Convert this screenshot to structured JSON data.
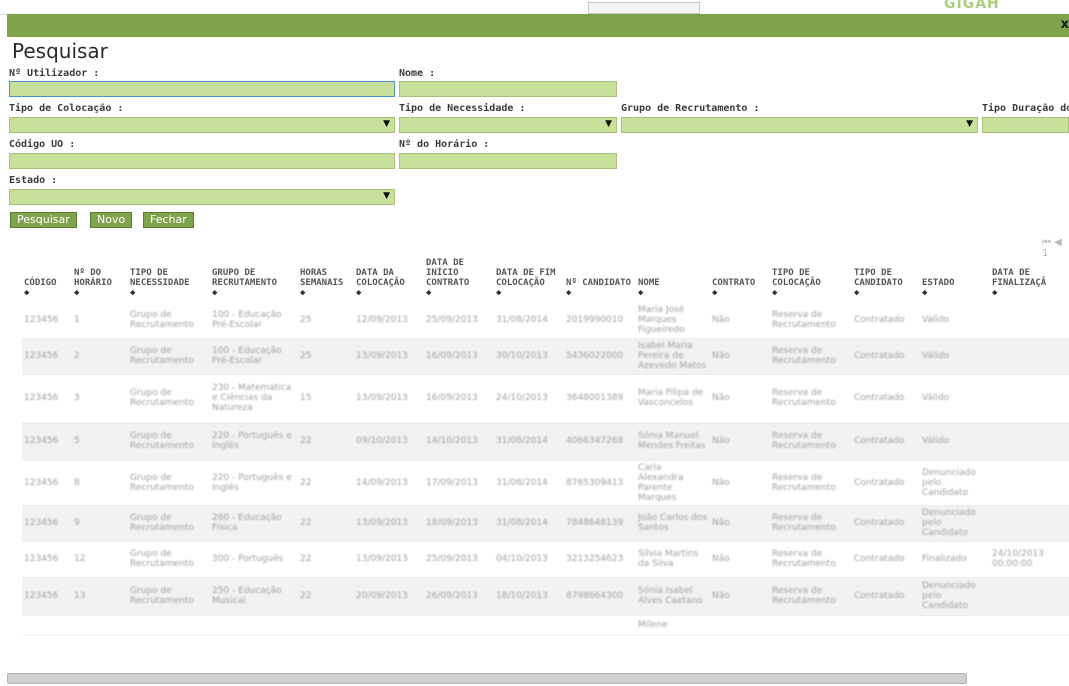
{
  "top": {
    "brand": "GIGAH"
  },
  "dialog": {
    "title": "Pesquisar",
    "close": "x"
  },
  "form": {
    "utilizador_label": "Nº Utilizador :",
    "nome_label": "Nome :",
    "tipo_colocacao_label": "Tipo de Colocação :",
    "tipo_necessidade_label": "Tipo de Necessidade :",
    "grupo_recrutamento_label": "Grupo de Recrutamento :",
    "tipo_duracao_label": "Tipo Duração do",
    "codigo_uo_label": "Código UO :",
    "horario_label": "Nº do Horário :",
    "estado_label": "Estado :"
  },
  "buttons": {
    "pesquisar": "Pesquisar",
    "novo": "Novo",
    "fechar": "Fechar"
  },
  "pager": "⏮ ◀ 1",
  "table": {
    "headers": [
      "CÓDIGO",
      "Nº DO HORÁRIO",
      "TIPO DE NECESSIDADE",
      "GRUPO DE RECRUTAMENTO",
      "HORAS SEMANAIS",
      "DATA DA COLOCAÇÃO",
      "DATA DE INÍCIO CONTRATO",
      "DATA DE FIM COLOCAÇÃO",
      "Nº CANDIDATO",
      "NOME",
      "CONTRATO",
      "TIPO DE COLOCAÇÃO",
      "TIPO DE CANDIDATO",
      "ESTADO",
      "DATA DE FINALIZAÇÃ"
    ],
    "rows": [
      [
        "123456",
        "1",
        "Grupo de Recrutamento",
        "100 - Educação Pré-Escolar",
        "25",
        "12/09/2013",
        "25/09/2013",
        "31/08/2014",
        "2019990010",
        "Maria José Marques Figueiredo",
        "Não",
        "Reserva de Recrutamento",
        "Contratado",
        "Válido",
        ""
      ],
      [
        "123456",
        "2",
        "Grupo de Recrutamento",
        "100 - Educação Pré-Escolar",
        "25",
        "13/09/2013",
        "16/09/2013",
        "30/10/2013",
        "5436022000",
        "Isabel Maria Pereira de Azevedo Matos",
        "Não",
        "Reserva de Recrutamento",
        "Contratado",
        "Válido",
        ""
      ],
      [
        "123456",
        "3",
        "Grupo de Recrutamento",
        "230 - Matemática e Ciências da Natureza",
        "15",
        "13/09/2013",
        "16/09/2013",
        "24/10/2013",
        "3648001389",
        "Maria Filipa de Vasconcelos",
        "Não",
        "Reserva de Recrutamento",
        "Contratado",
        "Válido",
        ""
      ],
      [
        "123456",
        "5",
        "Grupo de Recrutamento",
        "220 - Português e Inglês",
        "22",
        "09/10/2013",
        "14/10/2013",
        "31/08/2014",
        "4066347268",
        "Sónia Manuel Mendes Freitas",
        "Não",
        "Reserva de Recrutamento",
        "Contratado",
        "Válido",
        ""
      ],
      [
        "123456",
        "8",
        "Grupo de Recrutamento",
        "220 - Português e Inglês",
        "22",
        "14/09/2013",
        "17/09/2013",
        "31/08/2014",
        "8765309413",
        "Carla Alexandra Parente Marques",
        "Não",
        "Reserva de Recrutamento",
        "Contratado",
        "Denunciado pelo Candidato",
        ""
      ],
      [
        "123456",
        "9",
        "Grupo de Recrutamento",
        "260 - Educação Física",
        "22",
        "13/09/2013",
        "18/09/2013",
        "31/08/2014",
        "7848648139",
        "João Carlos dos Santos",
        "Não",
        "Reserva de Recrutamento",
        "Contratado",
        "Denunciado pelo Candidato",
        ""
      ],
      [
        "123456",
        "12",
        "Grupo de Recrutamento",
        "300 - Português",
        "22",
        "13/09/2013",
        "25/09/2013",
        "04/10/2013",
        "3213254623",
        "Sílvia Martins da Silva",
        "Não",
        "Reserva de Recrutamento",
        "Contratado",
        "Finalizado",
        "24/10/2013 00:00:00"
      ],
      [
        "123456",
        "13",
        "Grupo de Recrutamento",
        "250 - Educação Musical",
        "22",
        "20/09/2013",
        "26/09/2013",
        "18/10/2013",
        "8798664300",
        "Sónia Isabel Alves Caetano",
        "Não",
        "Reserva de Recrutamento",
        "Contratado",
        "Denunciado pelo Candidato",
        ""
      ],
      [
        "",
        "",
        "",
        "",
        "",
        "",
        "",
        "",
        "",
        "Milene",
        "",
        "",
        "",
        "",
        ""
      ]
    ]
  }
}
